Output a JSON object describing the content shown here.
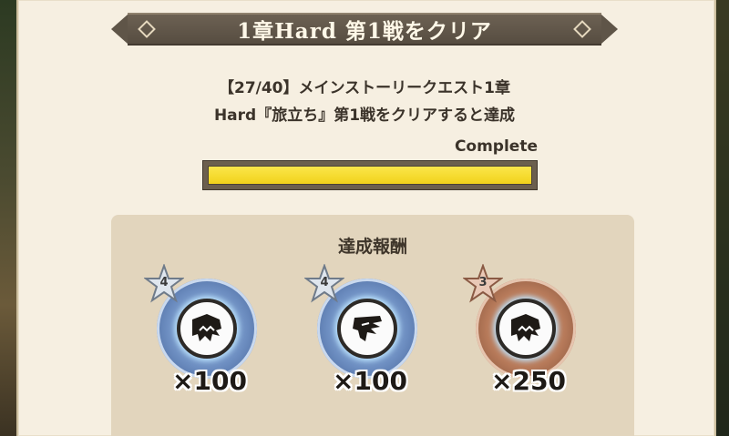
{
  "banner": {
    "title": "1章Hard 第1戦をクリア"
  },
  "quest": {
    "line1": "【27/40】メインストーリークエスト1章",
    "line2": "Hard『旅立ち』第1戦をクリアすると達成"
  },
  "progress": {
    "label": "Complete",
    "fraction": 1.0
  },
  "rewards": {
    "title": "達成報酬",
    "items": [
      {
        "stars": "4",
        "quantity": "×100",
        "icon": "monster-fang-icon",
        "medal": "silver"
      },
      {
        "stars": "4",
        "quantity": "×100",
        "icon": "monster-wing-icon",
        "medal": "silver"
      },
      {
        "stars": "3",
        "quantity": "×250",
        "icon": "monster-fang-icon",
        "medal": "bronze"
      }
    ]
  },
  "colors": {
    "banner": "#5f5548",
    "progress_fill": "#f1d21b",
    "panel": "#f6efe1",
    "reward_box": "#e2d5bd"
  }
}
